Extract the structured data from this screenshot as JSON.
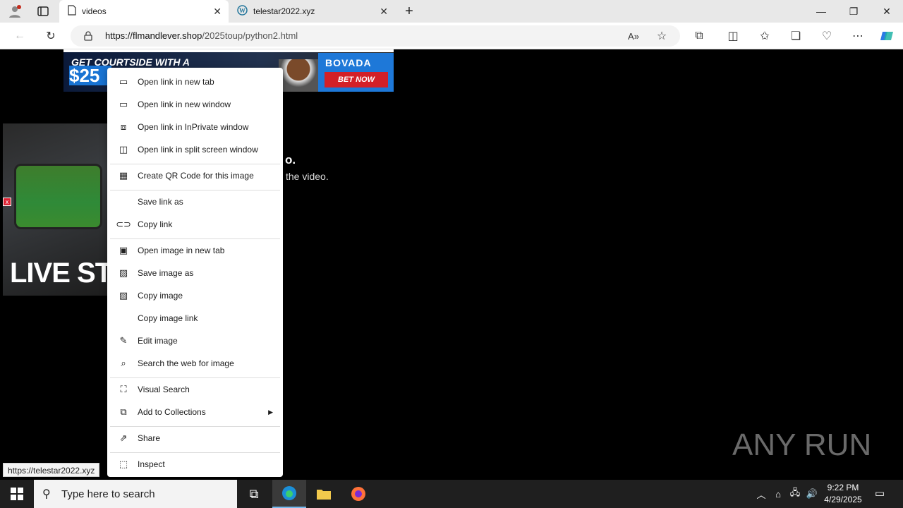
{
  "browser": {
    "tabs": [
      {
        "label": "videos",
        "icon": "page-icon"
      },
      {
        "label": "telestar2022.xyz",
        "icon": "wordpress-icon"
      }
    ],
    "url_host": "https://flmandlever.shop",
    "url_path": "/2025toup/python2.html",
    "status_url": "https://telestar2022.xyz"
  },
  "page": {
    "banner_headline": "GET COURTSIDE WITH A",
    "banner_amount": "$25",
    "brand": "BOVADA",
    "cta": "BET NOW",
    "live_text": "LIVE STR",
    "message_line1": "o.",
    "message_line2": "the video.",
    "close_glyph": "x",
    "watermark": "ANY RUN"
  },
  "context_menu": {
    "items": [
      {
        "label": "Open link in new tab",
        "icon": "new-tab-icon"
      },
      {
        "label": "Open link in new window",
        "icon": "new-window-icon"
      },
      {
        "label": "Open link in InPrivate window",
        "icon": "inprivate-icon"
      },
      {
        "label": "Open link in split screen window",
        "icon": "split-screen-icon"
      },
      {
        "label": "Create QR Code for this image",
        "icon": "qr-code-icon"
      },
      {
        "label": "Save link as",
        "icon": ""
      },
      {
        "label": "Copy link",
        "icon": "link-icon"
      },
      {
        "label": "Open image in new tab",
        "icon": "image-tab-icon"
      },
      {
        "label": "Save image as",
        "icon": "save-image-icon"
      },
      {
        "label": "Copy image",
        "icon": "copy-image-icon"
      },
      {
        "label": "Copy image link",
        "icon": ""
      },
      {
        "label": "Edit image",
        "icon": "edit-image-icon"
      },
      {
        "label": "Search the web for image",
        "icon": "image-search-icon"
      },
      {
        "label": "Visual Search",
        "icon": "visual-search-icon"
      },
      {
        "label": "Add to Collections",
        "icon": "collections-icon"
      },
      {
        "label": "Share",
        "icon": "share-icon"
      },
      {
        "label": "Inspect",
        "icon": "inspect-icon"
      }
    ]
  },
  "taskbar": {
    "search_placeholder": "Type here to search",
    "time": "9:22 PM",
    "date": "4/29/2025"
  }
}
